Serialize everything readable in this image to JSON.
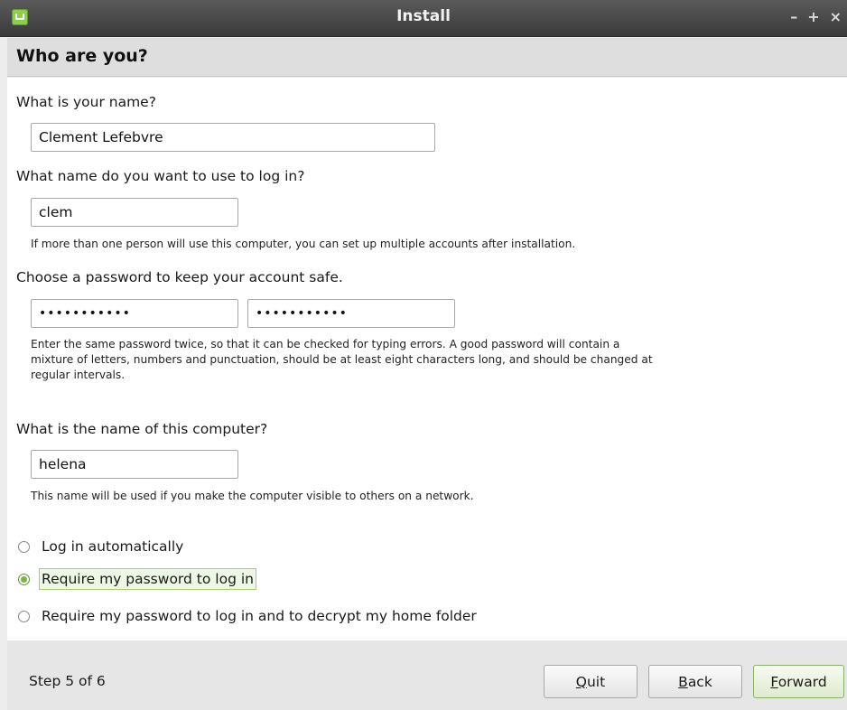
{
  "window": {
    "title": "Install",
    "controls": {
      "minimize": "–",
      "maximize": "+",
      "close": "×"
    }
  },
  "page": {
    "title": "Who are you?"
  },
  "form": {
    "name_label": "What is your name?",
    "name_value": "Clement Lefebvre",
    "login_label": "What name do you want to use to log in?",
    "login_value": "clem",
    "login_hint": "If more than one person will use this computer, you can set up multiple accounts after installation.",
    "password_label": "Choose a password to keep your account safe.",
    "password_value": "•••••••••••",
    "password_confirm_value": "•••••••••••",
    "password_hint_line1": "Enter the same password twice, so that it can be checked for typing errors. A good password will contain a",
    "password_hint_line2": "mixture of letters, numbers and punctuation, should be at least eight characters long, and should be changed at",
    "password_hint_line3": "regular intervals.",
    "hostname_label": "What is the name of this computer?",
    "hostname_value": "helena",
    "hostname_hint": "This name will be used if you make the computer visible to others on a network."
  },
  "login_options": [
    {
      "label": "Log in automatically",
      "checked": false
    },
    {
      "label": "Require my password to log in",
      "checked": true
    },
    {
      "label": "Require my password to log in and to decrypt my home folder",
      "checked": false
    }
  ],
  "footer": {
    "step": "Step 5 of 6",
    "quit_label": "Quit",
    "back_label": "Back",
    "forward_label": "Forward"
  },
  "colors": {
    "accent_green": "#78b543",
    "titlebar": "#3a3a3a"
  }
}
